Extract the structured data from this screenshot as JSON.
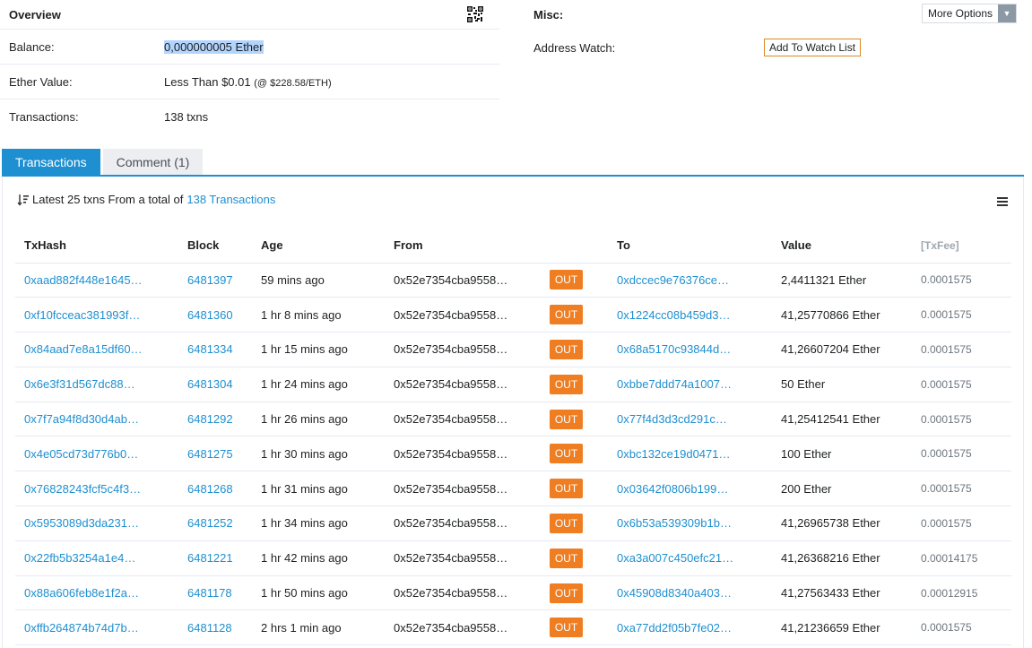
{
  "overview": {
    "title": "Overview",
    "balance_label": "Balance:",
    "balance_value": "0,000000005 Ether",
    "ether_value_label": "Ether Value:",
    "ether_value": "Less Than $0.01",
    "ether_price": "(@ $228.58/ETH)",
    "transactions_label": "Transactions:",
    "transactions_value": "138 txns"
  },
  "misc": {
    "title": "Misc:",
    "more_options_label": "More Options",
    "address_watch_label": "Address Watch:",
    "watch_button_label": "Add To Watch List"
  },
  "tabs": {
    "transactions": "Transactions",
    "comment": "Comment (1)"
  },
  "summary": {
    "prefix": "Latest 25 txns From a total of",
    "link": "138 Transactions"
  },
  "table": {
    "headers": {
      "txhash": "TxHash",
      "block": "Block",
      "age": "Age",
      "from": "From",
      "to": "To",
      "value": "Value",
      "fee": "[TxFee]"
    },
    "rows": [
      {
        "hash": "0xaad882f448e1645…",
        "block": "6481397",
        "age": "59 mins ago",
        "from": "0x52e7354cba9558…",
        "dir": "OUT",
        "to": "0xdccec9e76376ce…",
        "value": "2,4411321 Ether",
        "fee": "0.0001575"
      },
      {
        "hash": "0xf10fcceac381993f…",
        "block": "6481360",
        "age": "1 hr 8 mins ago",
        "from": "0x52e7354cba9558…",
        "dir": "OUT",
        "to": "0x1224cc08b459d3…",
        "value": "41,25770866 Ether",
        "fee": "0.0001575"
      },
      {
        "hash": "0x84aad7e8a15df60…",
        "block": "6481334",
        "age": "1 hr 15 mins ago",
        "from": "0x52e7354cba9558…",
        "dir": "OUT",
        "to": "0x68a5170c93844d…",
        "value": "41,26607204 Ether",
        "fee": "0.0001575"
      },
      {
        "hash": "0x6e3f31d567dc88…",
        "block": "6481304",
        "age": "1 hr 24 mins ago",
        "from": "0x52e7354cba9558…",
        "dir": "OUT",
        "to": "0xbbe7ddd74a1007…",
        "value": "50 Ether",
        "fee": "0.0001575"
      },
      {
        "hash": "0x7f7a94f8d30d4ab…",
        "block": "6481292",
        "age": "1 hr 26 mins ago",
        "from": "0x52e7354cba9558…",
        "dir": "OUT",
        "to": "0x77f4d3d3cd291c…",
        "value": "41,25412541 Ether",
        "fee": "0.0001575"
      },
      {
        "hash": "0x4e05cd73d776b0…",
        "block": "6481275",
        "age": "1 hr 30 mins ago",
        "from": "0x52e7354cba9558…",
        "dir": "OUT",
        "to": "0xbc132ce19d0471…",
        "value": "100 Ether",
        "fee": "0.0001575"
      },
      {
        "hash": "0x76828243fcf5c4f3…",
        "block": "6481268",
        "age": "1 hr 31 mins ago",
        "from": "0x52e7354cba9558…",
        "dir": "OUT",
        "to": "0x03642f0806b199…",
        "value": "200 Ether",
        "fee": "0.0001575"
      },
      {
        "hash": "0x5953089d3da231…",
        "block": "6481252",
        "age": "1 hr 34 mins ago",
        "from": "0x52e7354cba9558…",
        "dir": "OUT",
        "to": "0x6b53a539309b1b…",
        "value": "41,26965738 Ether",
        "fee": "0.0001575"
      },
      {
        "hash": "0x22fb5b3254a1e4…",
        "block": "6481221",
        "age": "1 hr 42 mins ago",
        "from": "0x52e7354cba9558…",
        "dir": "OUT",
        "to": "0xa3a007c450efc21…",
        "value": "41,26368216 Ether",
        "fee": "0.00014175"
      },
      {
        "hash": "0x88a606feb8e1f2a…",
        "block": "6481178",
        "age": "1 hr 50 mins ago",
        "from": "0x52e7354cba9558…",
        "dir": "OUT",
        "to": "0x45908d8340a403…",
        "value": "41,27563433 Ether",
        "fee": "0.00012915"
      },
      {
        "hash": "0xffb264874b74d7b…",
        "block": "6481128",
        "age": "2 hrs 1 min ago",
        "from": "0x52e7354cba9558…",
        "dir": "OUT",
        "to": "0xa77dd2f05b7fe02…",
        "value": "41,21236659 Ether",
        "fee": "0.0001575"
      }
    ]
  },
  "colors": {
    "link": "#1e8fd0",
    "out_badge": "#ef7d22",
    "tab_active": "#1e8fd0",
    "highlight": "#b3d4fc"
  },
  "icons": [
    "qr-code-icon",
    "sort-icon",
    "hamburger-menu-icon",
    "chevron-down-icon"
  ]
}
